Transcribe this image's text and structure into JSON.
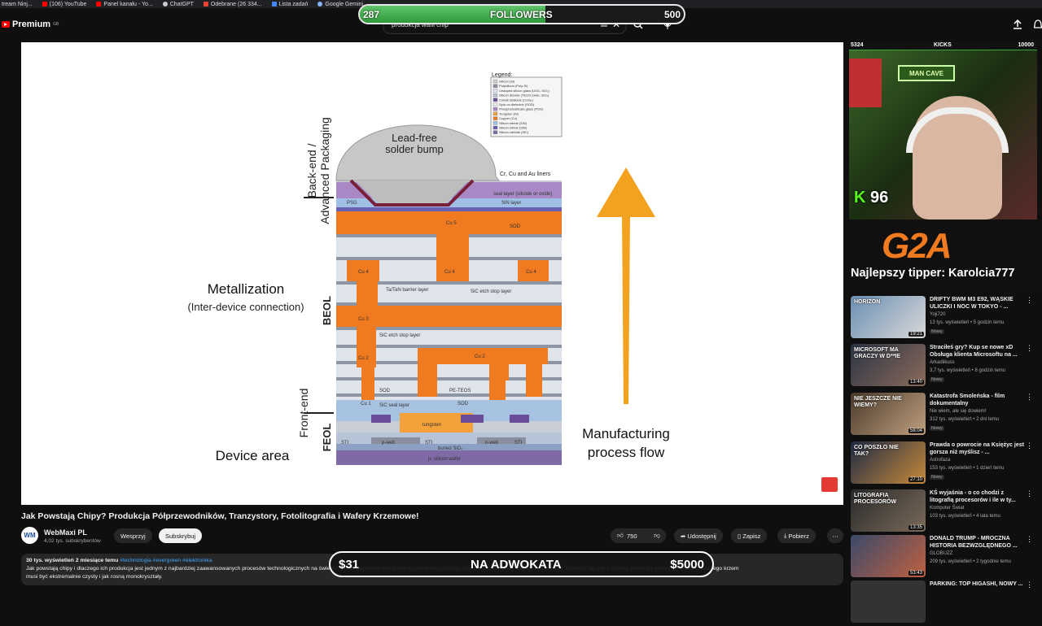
{
  "bookmarks": [
    "tream Ninj...",
    "(106) YouTube",
    "Panel kanału - Yo...",
    "ChatGPT",
    "Odebrane (26 334...",
    "Lista zadań",
    "Google Gemini"
  ],
  "header": {
    "logo": "Premium",
    "logo_sup": "GB",
    "search_value": "produkcja wafli chip"
  },
  "followers": {
    "current": "287",
    "label": "FOLLOWERS",
    "goal": "500",
    "progress_fraction": 0.574
  },
  "diagram": {
    "legend_title": "Legend:",
    "legend_items": [
      "Silicon (Si)",
      "Polysilicon (Poly-Si)",
      "Undoped silicon glass (USG, SiO₂)",
      "Silicon dioxide (TEOS oxide, SiO₂)",
      "Cobalt disilicide (CoSi₂)",
      "Spin-on dielectric (SOD)",
      "Phosphorosilicate glass (PSG)",
      "Tungsten (W)",
      "Copper (Cu)",
      "Silicon nitride (SiN)",
      "Silicon nitride (SiN)",
      "Silicon carbide (SiC)"
    ],
    "backend_label": "Back-end / Advanced Packaging",
    "bump_label": "Lead-free solder bump",
    "liners_label": "Cr, Cu and Au liners",
    "metal_title": "Metallization",
    "metal_sub": "(Inter-device connection)",
    "beol": "BEOL",
    "feol": "FEOL",
    "frontend": "Front-end",
    "device_area": "Device area",
    "mfg1": "Manufacturing",
    "mfg2": "process flow",
    "small": {
      "cu5": "Cu 5",
      "cu4a": "Cu 4",
      "cu4b": "Cu 4",
      "cu4c": "Cu 4",
      "cu3": "Cu 3",
      "cu2a": "Cu 2",
      "cu2b": "Cu 2",
      "cu1": "Cu 1",
      "sod1": "SOD",
      "sod2": "SOD",
      "sod3": "SOD",
      "peteos": "PE-TEOS",
      "psg": "PSG",
      "sin": "SiN layer",
      "seal": "seal layer (silicide or oxide)",
      "tatan": "Ta/TaN barrier layer",
      "sic1": "SiC etch stop layer",
      "sic2": "SiC etch stop layer",
      "sic3": "SiC seal layer",
      "tungsten": "tungsten",
      "pwell": "p-well",
      "nwell": "n-well",
      "sti1": "STI",
      "sti2": "STI",
      "sti3": "STI",
      "buried": "buried SiO₂",
      "psub": "p- silicon wafer"
    }
  },
  "video": {
    "title": "Jak Powstają Chipy? Produkcja Półprzewodników, Tranzystory, Fotolitografia i Wafery Krzemowe!",
    "channel": "WebMaxi PL",
    "avatar": "WM",
    "subs": "4,02 tys. subskrybentów",
    "support": "Wesprzyj",
    "subscribe": "Subskrybuj",
    "likes": "750",
    "share": "Udostępnij",
    "save": "Zapisz",
    "download": "Pobierz",
    "views": "30 tys. wyświetleń  2 miesiące temu",
    "tags": "#technologia #evergreen #elektronika",
    "desc1": "Jak powstają chipy i dlaczego ich produkcja jest jednym z najbardziej zaawansowanych procesów technologicznych na świecie? To szczegółowe evergreen wyjaśnienie pokazuje cały proces produkcji chipów od podstaw. Dowiesz się, jak z krzemu powstają wafery krzemowe, dlaczego krzem",
    "desc2": "musi być ekstremalnie czysty i jak rosną monokryształy."
  },
  "adwokat": {
    "left": "$31",
    "center": "NA ADWOKATA",
    "right": "$5000"
  },
  "cam": {
    "left_count": "5324",
    "kicks": "KICKS",
    "right_count": "10000",
    "k_count": "96",
    "sign": "MAN CAVE"
  },
  "tipper": {
    "brand": "G2A",
    "text": "Najlepszy tipper: Karolcia777"
  },
  "recommendations": [
    {
      "title": "DRIFTY BWM M3 E92, WĄSKIE ULICZKI I NOC W TOKYO - ...",
      "channel": "Yoji720",
      "meta": "13 tys. wyświetleń • 5 godzin temu",
      "badge": "Nowy",
      "duration": "19:21"
    },
    {
      "title": "Straciłeś gry? Kup se nowe xD Obsługa klienta Microsoftu na ...",
      "channel": "Arkadiikuss",
      "meta": "3,7 tys. wyświetleń • 8 godzin temu",
      "badge": "Nowy",
      "duration": "13:40"
    },
    {
      "title": "Katastrofa Smoleńska - film dokumentalny",
      "channel": "Nie wiem, ale się dowiem!",
      "meta": "312 tys. wyświetleń • 2 dni temu",
      "badge": "Nowy",
      "duration": "58:04"
    },
    {
      "title": "Prawda o powrocie na Księżyc jest gorsza niż myślisz - ...",
      "channel": "Astrofaza",
      "meta": "153 tys. wyświetleń • 1 dzień temu",
      "badge": "Nowy",
      "duration": "27:10"
    },
    {
      "title": "KŚ wyjaśnia - o co chodzi z litografią procesorów i ile w ty...",
      "channel": "Komputer Świat",
      "meta": "103 tys. wyświetleń • 4 lata temu",
      "badge": "",
      "duration": "13:35"
    },
    {
      "title": "DONALD TRUMP - MROCZNA HISTORIA BEZWZGLĘDNEGO ...",
      "channel": "GLOBUZZ",
      "meta": "209 tys. wyświetleń • 2 tygodnie temu",
      "badge": "",
      "duration": "53:43"
    },
    {
      "title": "PARKING: TOP HIGASHI, NOWY ...",
      "channel": "",
      "meta": "",
      "badge": "",
      "duration": ""
    }
  ],
  "thumb_texts": [
    "HORIZON",
    "MICROSOFT MA GRACZY W D**IE",
    "NIE JESZCZE NIE WIEMY?",
    "CO POSZŁO NIE TAK?",
    "LITOGRAFIA PROCESORÓW",
    "",
    ""
  ],
  "colors": {
    "accent_red": "#ff0000",
    "copper": "#f07a1f",
    "arrow": "#f3a21f",
    "followers_green": "#3aa64a",
    "link_blue": "#3ea6ff"
  }
}
